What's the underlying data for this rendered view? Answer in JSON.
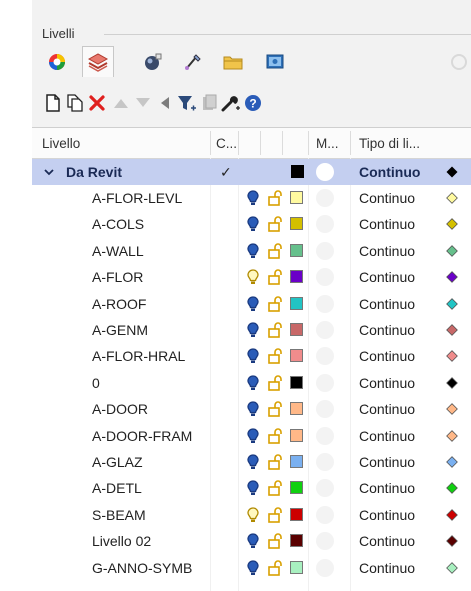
{
  "panel": {
    "title": "Livelli"
  },
  "tabs": [
    {
      "name": "color-wheel-icon",
      "color": "#d33"
    },
    {
      "name": "layers-icon",
      "color": "#d8534f"
    },
    {
      "name": "object-properties-icon",
      "color": "#3a5a8c"
    },
    {
      "name": "render-brush-icon",
      "color": "#4f6fa8"
    },
    {
      "name": "folder-icon",
      "color": "#e2b33c"
    },
    {
      "name": "display-icon",
      "color": "#2e70b8"
    }
  ],
  "header": {
    "name": "Livello",
    "current": "C...",
    "material": "M...",
    "linetype": "Tipo di li..."
  },
  "parent": {
    "label": "Da Revit",
    "check": "✓",
    "color": "#000000",
    "linetype": "Continuo"
  },
  "layers": [
    {
      "name": "A-FLOR-LEVL",
      "color": "#fffaa0",
      "bulb_on": true,
      "linetype": "Continuo"
    },
    {
      "name": "A-COLS",
      "color": "#d4c000",
      "bulb_on": true,
      "linetype": "Continuo"
    },
    {
      "name": "A-WALL",
      "color": "#66c08c",
      "bulb_on": true,
      "linetype": "Continuo"
    },
    {
      "name": "A-FLOR",
      "color": "#6a00c8",
      "bulb_on": false,
      "linetype": "Continuo"
    },
    {
      "name": "A-ROOF",
      "color": "#22c4c4",
      "bulb_on": true,
      "linetype": "Continuo"
    },
    {
      "name": "A-GENM",
      "color": "#c86868",
      "bulb_on": true,
      "linetype": "Continuo"
    },
    {
      "name": "A-FLOR-HRAL",
      "color": "#f08c8c",
      "bulb_on": true,
      "linetype": "Continuo"
    },
    {
      "name": "0",
      "color": "#000000",
      "bulb_on": true,
      "linetype": "Continuo"
    },
    {
      "name": "A-DOOR",
      "color": "#ffb888",
      "bulb_on": true,
      "linetype": "Continuo"
    },
    {
      "name": "A-DOOR-FRAM",
      "color": "#ffb888",
      "bulb_on": true,
      "linetype": "Continuo"
    },
    {
      "name": "A-GLAZ",
      "color": "#7ab0f0",
      "bulb_on": true,
      "linetype": "Continuo"
    },
    {
      "name": "A-DETL",
      "color": "#10d010",
      "bulb_on": true,
      "linetype": "Continuo"
    },
    {
      "name": "S-BEAM",
      "color": "#cc0000",
      "bulb_on": false,
      "linetype": "Continuo"
    },
    {
      "name": "Livello 02",
      "color": "#5a0000",
      "bulb_on": true,
      "linetype": "Continuo"
    },
    {
      "name": "G-ANNO-SYMB",
      "color": "#a8f0c0",
      "bulb_on": true,
      "linetype": "Continuo"
    }
  ]
}
